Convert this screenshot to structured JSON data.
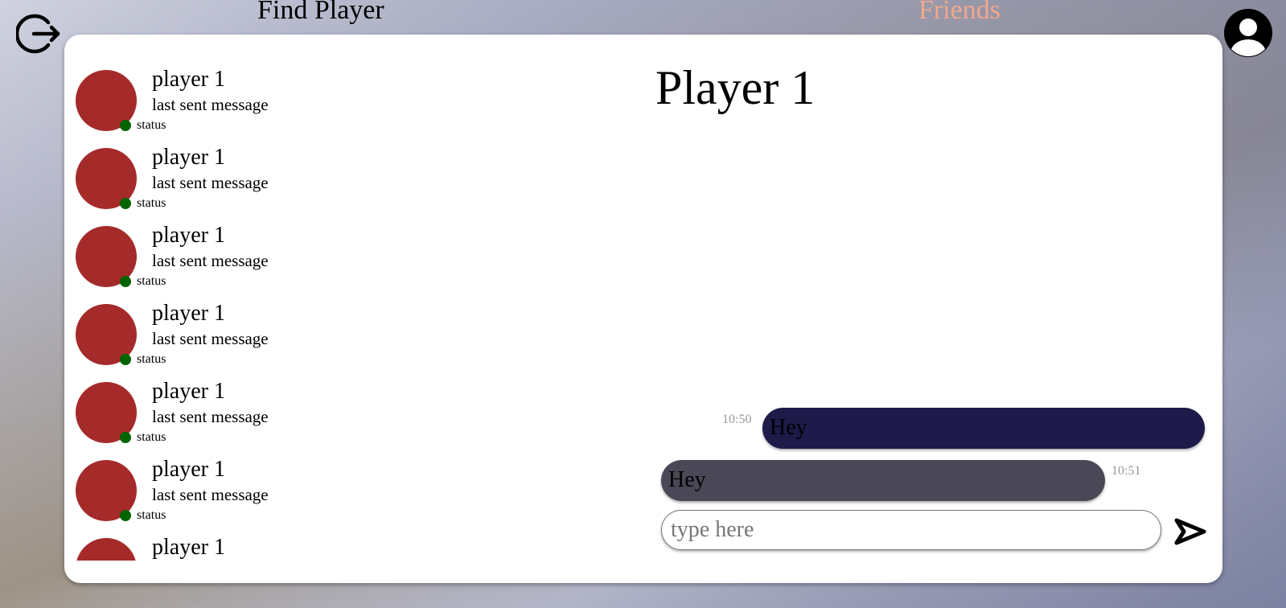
{
  "header": {
    "logout_icon": "logout-icon",
    "nav_find_label": "Find Player",
    "nav_friends_label": "Friends",
    "profile_icon": "user-avatar-icon",
    "friends_color": "#f4a78c"
  },
  "friends": [
    {
      "name": "player 1",
      "last_message": "last sent message",
      "status": "status"
    },
    {
      "name": "player 1",
      "last_message": "last sent message",
      "status": "status"
    },
    {
      "name": "player 1",
      "last_message": "last sent message",
      "status": "status"
    },
    {
      "name": "player 1",
      "last_message": "last sent message",
      "status": "status"
    },
    {
      "name": "player 1",
      "last_message": "last sent message",
      "status": "status"
    },
    {
      "name": "player 1",
      "last_message": "last sent message",
      "status": "status"
    },
    {
      "name": "player 1",
      "last_message": "",
      "status": ""
    }
  ],
  "friend_colors": {
    "avatar": "#a52a2a",
    "online_dot": "#006400"
  },
  "chat": {
    "title": "Player 1",
    "messages": [
      {
        "direction": "out",
        "text": "Hey",
        "time": "10:50",
        "color": "#1e1a4a"
      },
      {
        "direction": "in",
        "text": "Hey",
        "time": "10:51",
        "color": "#4a4856"
      }
    ],
    "input_placeholder": "type here",
    "input_value": "",
    "send_icon": "send-icon"
  }
}
